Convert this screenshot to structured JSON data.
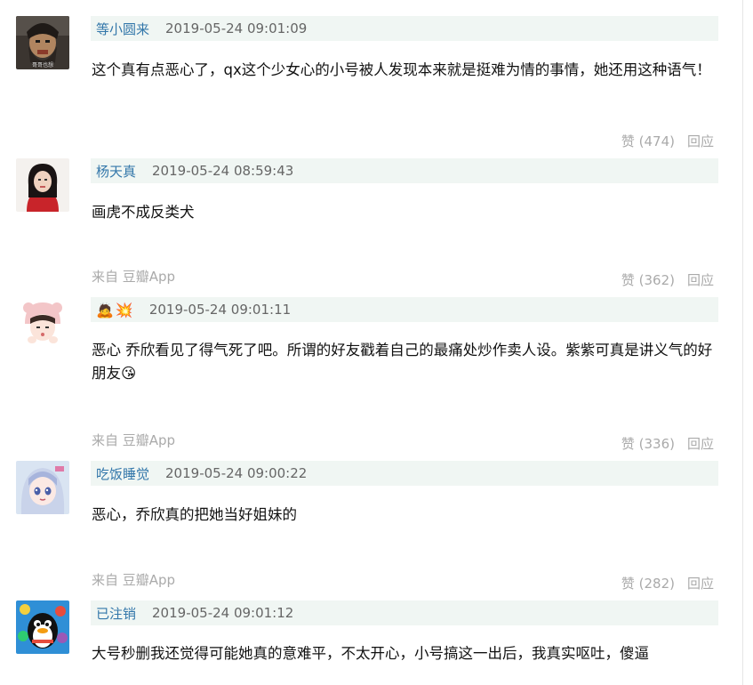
{
  "comments": [
    {
      "author": "等小圆来",
      "time": "2019-05-24 09:01:09",
      "avatar_icon": "bearded-man-avatar",
      "content": "这个真有点恶心了，qx这个少女心的小号被人发现本来就是挺难为情的事情，她还用这种语气！",
      "like_label": "赞 (474)",
      "reply_label": "回应"
    },
    {
      "author": "杨天真",
      "time": "2019-05-24 08:59:43",
      "avatar_icon": "woman-red-top-avatar",
      "content": "画虎不成反类犬",
      "source": "来自 豆瓣App",
      "like_label": "赞 (362)",
      "reply_label": "回应"
    },
    {
      "author_emojis": [
        "🙇",
        "💥"
      ],
      "time": "2019-05-24 09:01:11",
      "avatar_icon": "girl-pink-hat-avatar",
      "content": "恶心 乔欣看见了得气死了吧。所谓的好友戳着自己的最痛处炒作卖人设。紫紫可真是讲义气的好朋友",
      "content_emoji": "😘",
      "source": "来自 豆瓣App",
      "like_label": "赞 (336)",
      "reply_label": "回应"
    },
    {
      "author": "吃饭睡觉",
      "time": "2019-05-24 09:00:22",
      "avatar_icon": "anime-girl-avatar",
      "content": "恶心，乔欣真的把她当好姐妹的",
      "source": "来自 豆瓣App",
      "like_label": "赞 (282)",
      "reply_label": "回应"
    },
    {
      "author": "已注销",
      "time": "2019-05-24 09:01:12",
      "avatar_icon": "cartoon-penguin-avatar",
      "content": "大号秒删我还觉得可能她真的意难平，不太开心，小号搞这一出后，我真实呕吐，傻逼"
    }
  ]
}
